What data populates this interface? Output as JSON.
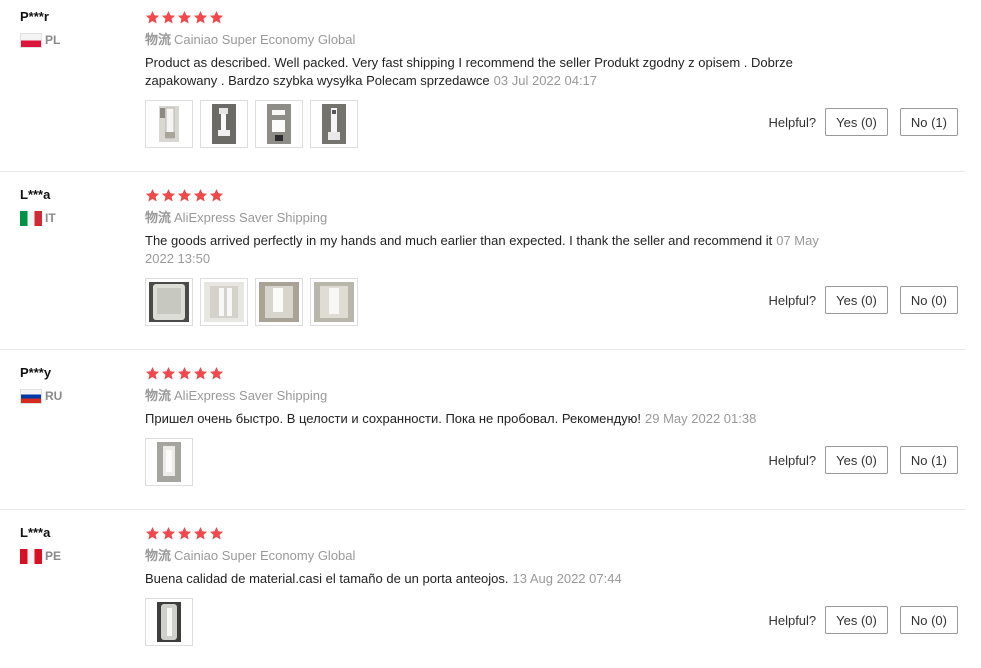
{
  "helpful_label": "Helpful?",
  "shipping_prefix": "物流",
  "star_color": "#f0494b",
  "reviews": [
    {
      "user": "P***r",
      "country_code": "PL",
      "flag": "poland-flag",
      "rating": 5,
      "shipping": "Cainiao Super Economy Global",
      "text": "Product as described. Well packed. Very fast shipping I recommend the seller Produkt zgodny z opisem . Dobrze zapakowany . Bardzo szybka wysyłka Polecam sprzedawce",
      "date": "03 Jul 2022 04:17",
      "photo_count": 4,
      "yes_label": "Yes (0)",
      "no_label": "No (1)"
    },
    {
      "user": "L***a",
      "country_code": "IT",
      "flag": "italy-flag",
      "rating": 5,
      "shipping": "AliExpress Saver Shipping",
      "text": "The goods arrived perfectly in my hands and much earlier than expected. I thank the seller and recommend it",
      "date": "07 May 2022 13:50",
      "photo_count": 4,
      "yes_label": "Yes (0)",
      "no_label": "No (0)"
    },
    {
      "user": "P***y",
      "country_code": "RU",
      "flag": "russia-flag",
      "rating": 5,
      "shipping": "AliExpress Saver Shipping",
      "text": "Пришел очень быстро. В целости и сохранности. Пока не пробовал. Рекомендую!",
      "date": "29 May 2022 01:38",
      "photo_count": 1,
      "yes_label": "Yes (0)",
      "no_label": "No (1)"
    },
    {
      "user": "L***a",
      "country_code": "PE",
      "flag": "peru-flag",
      "rating": 5,
      "shipping": "Cainiao Super Economy Global",
      "text": "Buena calidad de material.casi el tamaño de un porta anteojos.",
      "date": "13 Aug 2022 07:44",
      "photo_count": 1,
      "yes_label": "Yes (0)",
      "no_label": "No (0)"
    }
  ]
}
